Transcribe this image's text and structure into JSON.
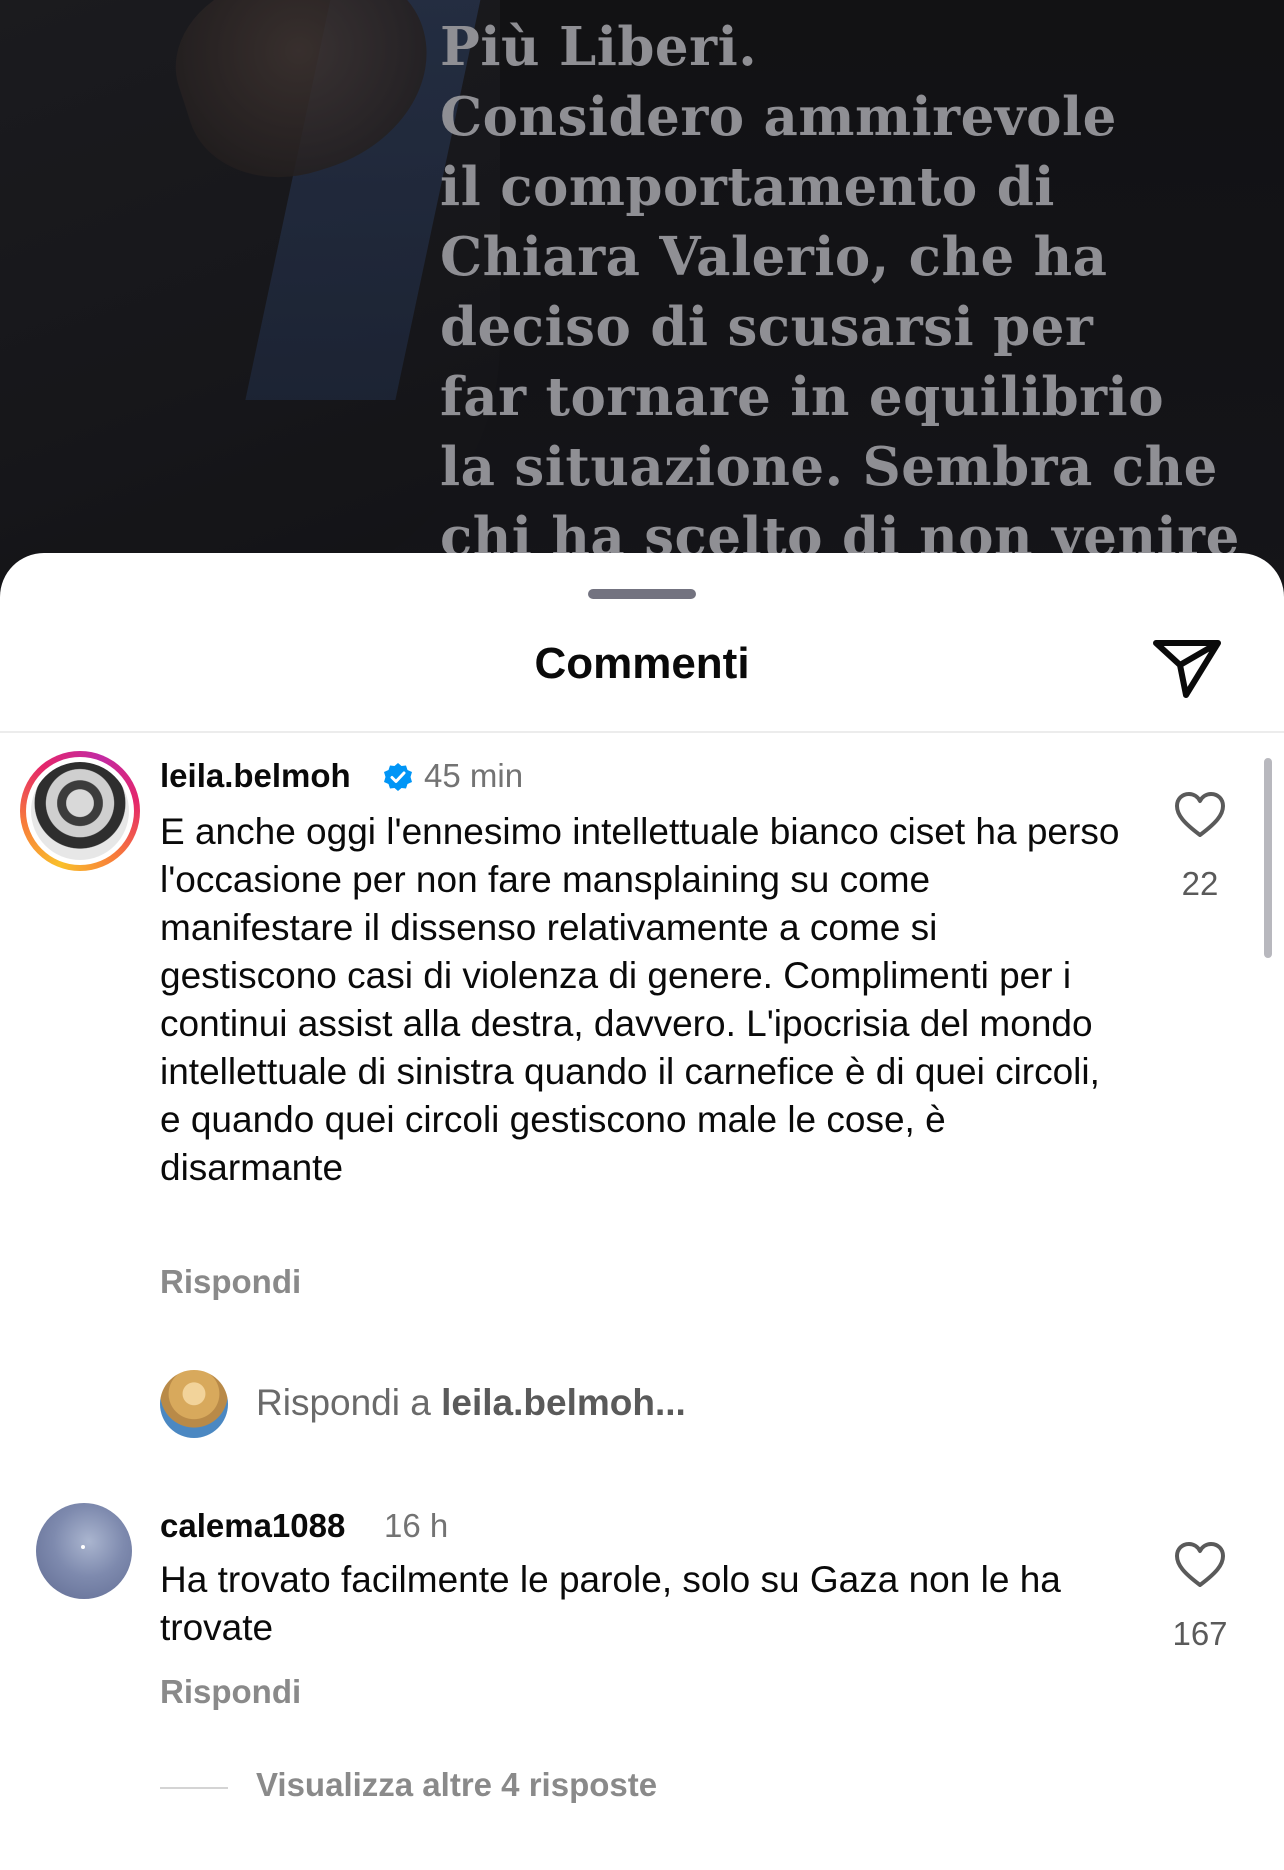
{
  "post": {
    "text_lines": [
      "Più Liberi.",
      "Considero ammirevole",
      "il comportamento di",
      "Chiara Valerio, che ha",
      "deciso di scusarsi per",
      "far tornare in equilibrio",
      "la situazione. Sembra che",
      "chi ha scelto di non venire"
    ]
  },
  "sheet": {
    "title": "Commenti",
    "share_icon": "paper-plane-icon"
  },
  "comments": [
    {
      "username": "leila.belmoh",
      "verified": true,
      "time": "45 min",
      "text": "E anche oggi l'ennesimo intellettuale bianco ciset ha perso l'occasione per non fare mansplaining su come manifestare il dissenso relativamente a come si gestiscono casi di violenza di genere. Complimenti per i continui assist alla destra, davvero. L'ipocrisia del mondo intellettuale di sinistra quando il carnefice è di quei circoli, e quando quei circoli gestiscono male le cose, è disarmante",
      "reply_label": "Rispondi",
      "likes": "22"
    },
    {
      "username": "calema1088",
      "verified": false,
      "time": "16 h",
      "text": "Ha trovato facilmente le parole, solo su Gaza non le ha trovate",
      "reply_label": "Rispondi",
      "likes": "167"
    }
  ],
  "reply_input": {
    "prefix": "Rispondi a",
    "target": "leila.belmoh..."
  },
  "more_replies": "Visualizza altre 4 risposte",
  "colors": {
    "verified": "#0095f6",
    "muted": "#737373",
    "ring_start": "#f9c02b",
    "ring_end": "#c22aa3"
  }
}
